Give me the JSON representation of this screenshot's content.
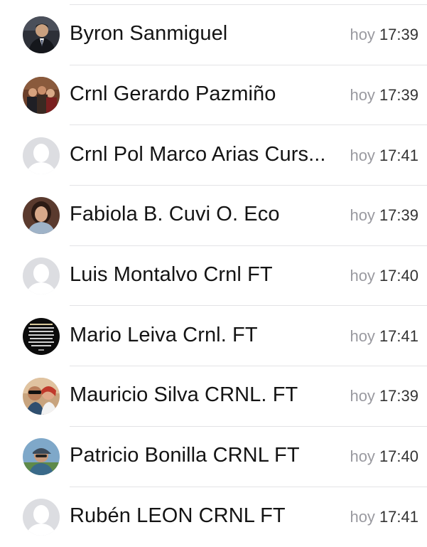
{
  "contacts": [
    {
      "name": "Byron Sanmiguel",
      "day": "hoy",
      "time": "17:39",
      "avatar": "photo-man-suit"
    },
    {
      "name": "Crnl Gerardo Pazmiño",
      "day": "hoy",
      "time": "17:39",
      "avatar": "photo-group"
    },
    {
      "name": "Crnl Pol Marco Arias Curs...",
      "day": "hoy",
      "time": "17:41",
      "avatar": "default-person"
    },
    {
      "name": "Fabiola B. Cuvi O. Eco",
      "day": "hoy",
      "time": "17:39",
      "avatar": "photo-woman"
    },
    {
      "name": "Luis Montalvo Crnl FT",
      "day": "hoy",
      "time": "17:40",
      "avatar": "default-person"
    },
    {
      "name": "Mario Leiva Crnl. FT",
      "day": "hoy",
      "time": "17:41",
      "avatar": "photo-text-card"
    },
    {
      "name": "Mauricio Silva CRNL. FT",
      "day": "hoy",
      "time": "17:39",
      "avatar": "photo-couple"
    },
    {
      "name": "Patricio Bonilla CRNL FT",
      "day": "hoy",
      "time": "17:40",
      "avatar": "photo-man-cap"
    },
    {
      "name": "Rubén LEON CRNL FT",
      "day": "hoy",
      "time": "17:41",
      "avatar": "default-person"
    }
  ]
}
